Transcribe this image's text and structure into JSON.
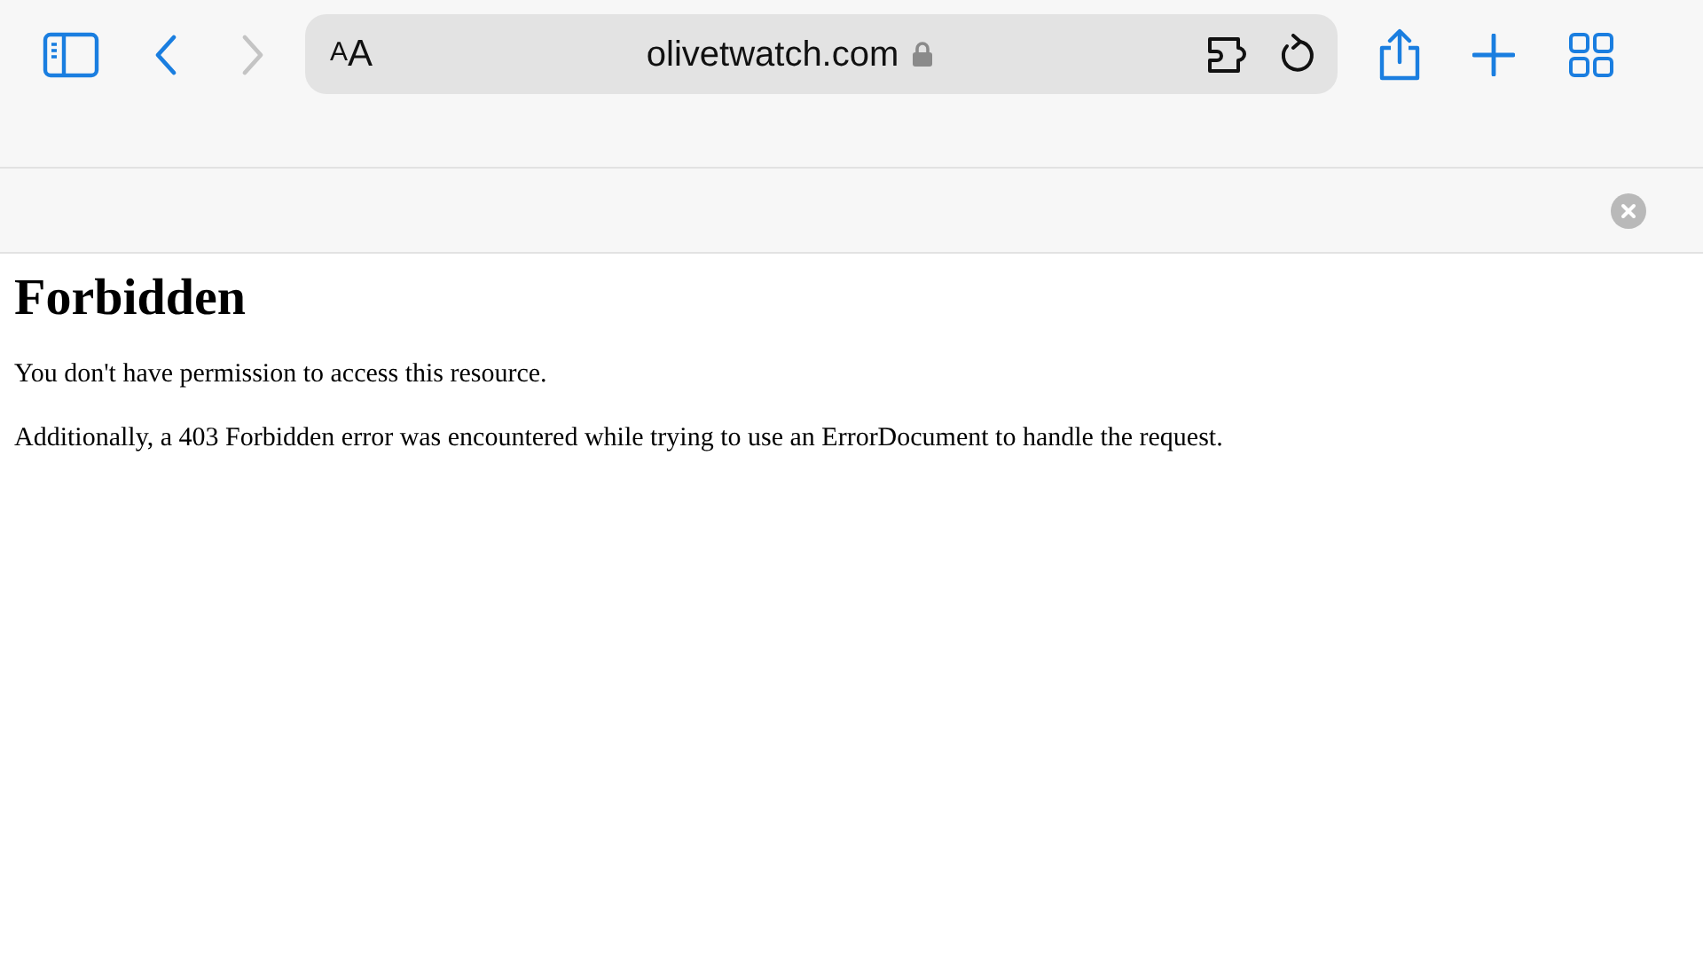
{
  "toolbar": {
    "back": {
      "disabled": false
    },
    "forward": {
      "disabled": true
    },
    "format_button": {
      "small_letter": "A",
      "large_letter": "A"
    },
    "address": {
      "url": "olivetwatch.com",
      "secure": true
    }
  },
  "banner": {
    "closable": true
  },
  "page": {
    "heading": "Forbidden",
    "paragraphs": [
      "You don't have permission to access this resource.",
      "Additionally, a 403 Forbidden error was encountered while trying to use an ErrorDocument to handle the request."
    ]
  }
}
